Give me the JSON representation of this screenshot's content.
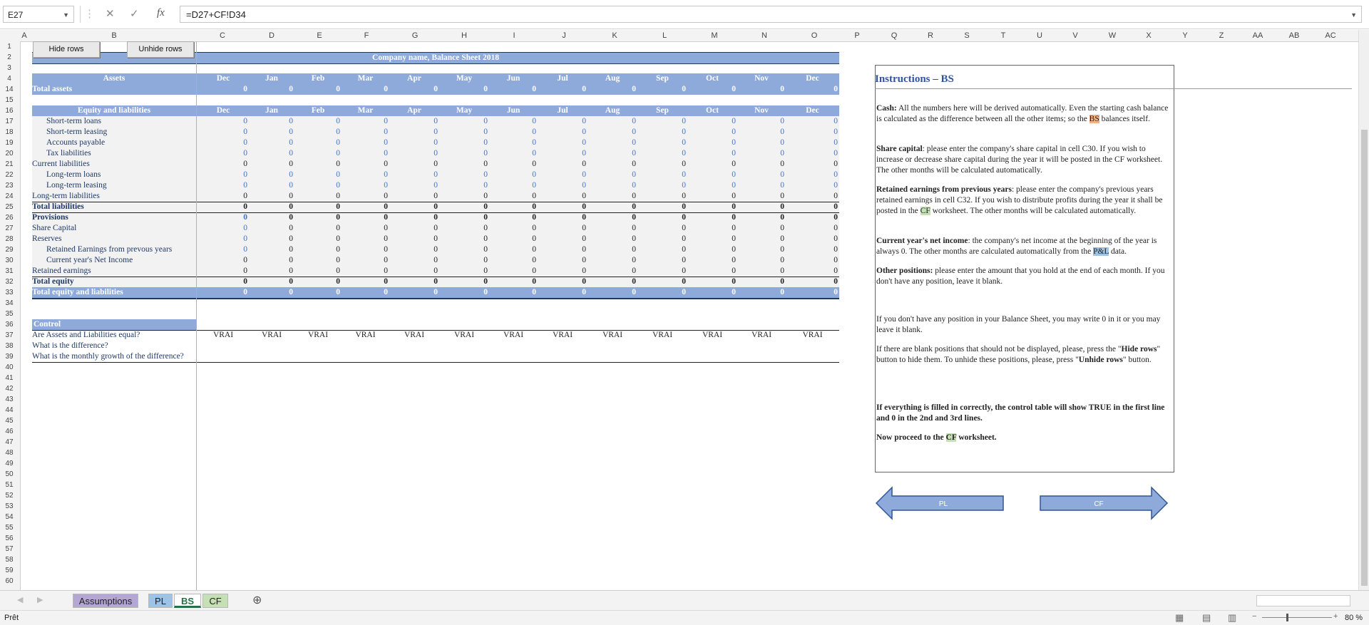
{
  "formula_bar": {
    "cell_ref": "E27",
    "formula": "=D27+CF!D34",
    "cancel_icon": "cancel-icon",
    "enter_icon": "check-icon",
    "fx_label": "fx"
  },
  "columns": [
    "A",
    "B",
    "C",
    "D",
    "E",
    "F",
    "G",
    "H",
    "I",
    "J",
    "K",
    "L",
    "M",
    "N",
    "O",
    "P",
    "Q",
    "R",
    "S",
    "T",
    "U",
    "V",
    "W",
    "X",
    "Y",
    "Z",
    "AA",
    "AB",
    "AC"
  ],
  "row_numbers": [
    "1",
    "2",
    "3",
    "4",
    "14",
    "15",
    "16",
    "17",
    "18",
    "19",
    "20",
    "21",
    "22",
    "23",
    "24",
    "25",
    "26",
    "27",
    "28",
    "29",
    "30",
    "31",
    "32",
    "33",
    "34",
    "35",
    "36",
    "37",
    "38",
    "39",
    "40",
    "41",
    "42",
    "43",
    "44",
    "45",
    "46",
    "47",
    "48",
    "49",
    "50",
    "51",
    "52",
    "53",
    "54",
    "55",
    "56",
    "57",
    "58",
    "59",
    "60"
  ],
  "buttons": {
    "hide": "Hide rows",
    "unhide": "Unhide rows"
  },
  "sheet": {
    "title": "Company name, Balance Sheet 2018",
    "months": [
      "Dec",
      "Jan",
      "Feb",
      "Mar",
      "Apr",
      "May",
      "Jun",
      "Jul",
      "Aug",
      "Sep",
      "Oct",
      "Nov",
      "Dec"
    ],
    "assets_header": "Assets",
    "total_assets": "Total assets",
    "equity_header": "Equity and liabilities",
    "zero": "0",
    "rows": [
      {
        "label": "Short-term loans",
        "indent": true,
        "style": "input"
      },
      {
        "label": "Short-term leasing",
        "indent": true,
        "style": "input"
      },
      {
        "label": "Accounts payable",
        "indent": true,
        "style": "input"
      },
      {
        "label": "Tax liabilities",
        "indent": true,
        "style": "input"
      },
      {
        "label": "Current liabilities",
        "indent": false,
        "style": "calc"
      },
      {
        "label": "Long-term loans",
        "indent": true,
        "style": "input"
      },
      {
        "label": "Long-term leasing",
        "indent": true,
        "style": "input"
      },
      {
        "label": "Long-term liabilities",
        "indent": false,
        "style": "calc"
      },
      {
        "label": "Total liabilities",
        "indent": false,
        "style": "bold"
      },
      {
        "label": "Provisions",
        "indent": false,
        "style": "bold-input"
      },
      {
        "label": "Share Capital",
        "indent": false,
        "style": "input-first"
      },
      {
        "label": "Reserves",
        "indent": false,
        "style": "input-first"
      },
      {
        "label": "Retained Earnings from prevous years",
        "indent": true,
        "style": "input-first"
      },
      {
        "label": "Current year's Net Income",
        "indent": true,
        "style": "calc"
      },
      {
        "label": "Retained earnings",
        "indent": false,
        "style": "calc"
      },
      {
        "label": "Total equity",
        "indent": false,
        "style": "bold"
      }
    ],
    "total_equity_liab": "Total equity and liabilities",
    "control": {
      "header": "Control",
      "q1": "Are Assets and Liabilities equal?",
      "q2": "What is the difference?",
      "q3": "What is the monthly growth of the difference?",
      "vrai": "VRAI"
    }
  },
  "instructions": {
    "title": "Instructions – BS",
    "cash_b": "Cash:",
    "cash_t": " All the numbers here will be derived automatically. Even the starting cash balance is calculated as the difference between all the other items; so the ",
    "cash_hl": "BS",
    "cash_e": " balances itself.",
    "share_b": "Share capital",
    "share_t": ": please enter the company's share capital in cell C30. If you wish to increase or decrease share capital during the year it will be posted in the CF worksheet. The other months will be calculated automatically.",
    "ret_b": "Retained earnings from previous years",
    "ret_t": ": please enter the company's previous years retained earnings in cell C32. If you wish to distribute profits during the year it shall be posted in the ",
    "ret_hl": "CF",
    "ret_e": " worksheet. The other months will be calculated automatically.",
    "cur_b": "Current year's net income",
    "cur_t": ": the company's net income at the beginning of the year is always 0. The other months are calculated automatically from the ",
    "cur_hl": "P&L",
    "cur_e": " data.",
    "oth_b": "Other positions:",
    "oth_t": " please enter the amount that you hold at the end of each month. If you don't have any position, leave it blank.",
    "p6": "If you don't have any position in your Balance Sheet, you may write 0 in it or you may leave it blank.",
    "p7a": "If there are blank positions that should not be displayed, please, press the \"",
    "p7b": "Hide rows",
    "p7c": "\" button to hide them. To unhide these positions, please, press \"",
    "p7d": "Unhide rows",
    "p7e": "\" button.",
    "p8": "If everything is filled in correctly, the control table will show TRUE in the first line and 0 in the 2nd and 3rd lines.",
    "p9a": "Now proceed to the ",
    "p9b": "CF",
    "p9c": " worksheet."
  },
  "nav": {
    "prev": "PL",
    "next": "CF",
    "fill": "#8eaadb",
    "stroke": "#2f5597"
  },
  "tabs": [
    {
      "label": "Assumptions",
      "color": "#b4a7d6",
      "active": false
    },
    {
      "label": "PL",
      "color": "#9dc3e6",
      "active": false
    },
    {
      "label": "BS",
      "color": "#ffffff",
      "active": true
    },
    {
      "label": "CF",
      "color": "#c5e0b4",
      "active": false
    }
  ],
  "status": {
    "ready": "Prêt",
    "zoom": "80 %"
  }
}
